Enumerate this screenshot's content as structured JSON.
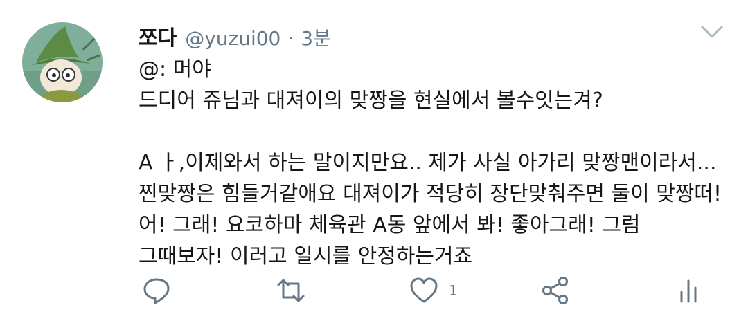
{
  "tweet": {
    "display_name": "쪼다",
    "handle": "@yuzui00",
    "separator": "·",
    "time": "3분",
    "lines": [
      "@: 머야",
      "드디어 쥬님과 대져이의 맞짱을 현실에서 볼수잇는겨?",
      "",
      "A ㅏ,이제와서 하는 말이지만요.. 제가 사실 아가리 맞짱맨이라서...",
      "찐맞짱은 힘들거같애요 대져이가 적당히 장단맞춰주면 둘이 맞짱떠!",
      "어! 그래! 요코하마 체육관 A동 앞에서 봐! 좋아그래! 그럼",
      "그때보자! 이러고 일시를 안정하는거죠"
    ],
    "like_count": "1"
  },
  "icons": {
    "caret": "chevron-down-icon",
    "reply": "reply-icon",
    "retweet": "retweet-icon",
    "like": "heart-icon",
    "share": "share-icon",
    "analytics": "analytics-icon",
    "avatar": "moomin-snufkin-avatar"
  },
  "colors": {
    "text": "#14171a",
    "secondary": "#657786",
    "background": "#ffffff"
  }
}
